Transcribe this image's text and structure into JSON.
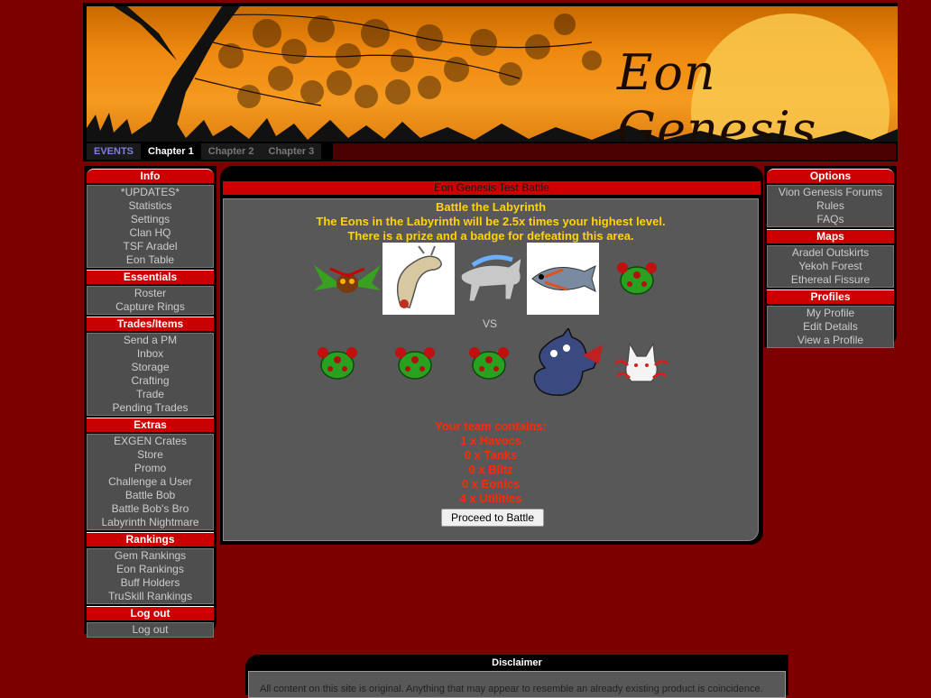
{
  "site": {
    "title": "Eon Genesis"
  },
  "tabs": [
    {
      "label": "EVENTS"
    },
    {
      "label": "Chapter 1"
    },
    {
      "label": "Chapter 2"
    },
    {
      "label": "Chapter 3"
    }
  ],
  "left_menu": [
    {
      "title": "Info",
      "items": [
        "*UPDATES*",
        "Statistics",
        "Settings",
        "Clan HQ",
        "TSF Aradel",
        "Eon Table"
      ]
    },
    {
      "title": "Essentials",
      "items": [
        "Roster",
        "Capture Rings"
      ]
    },
    {
      "title": "Trades/Items",
      "items": [
        "Send a PM",
        "Inbox",
        "Storage",
        "Crafting",
        "Trade",
        "Pending Trades"
      ]
    },
    {
      "title": "Extras",
      "items": [
        "EXGEN Crates",
        "Store",
        "Promo",
        "Challenge a User",
        "Battle Bob",
        "Battle Bob's Bro",
        "Labyrinth Nightmare"
      ]
    },
    {
      "title": "Rankings",
      "items": [
        "Gem Rankings",
        "Eon Rankings",
        "Buff Holders",
        "TruSkill Rankings"
      ]
    },
    {
      "title": "Log out",
      "items": [
        "Log out"
      ]
    }
  ],
  "right_menu": [
    {
      "title": "Options",
      "items": [
        "Vion Genesis Forums",
        "Rules",
        "FAQs"
      ]
    },
    {
      "title": "Maps",
      "items": [
        "Aradel Outskirts",
        "Yekoh Forest",
        "Ethereal Fissure"
      ]
    },
    {
      "title": "Profiles",
      "items": [
        "My Profile",
        "Edit Details",
        "View a Profile"
      ]
    }
  ],
  "battle": {
    "title": "Eon Genesis Test Battle",
    "heading": "Battle the Labyrinth",
    "line1": "The Eons in the Labyrinth will be 2.5x times your highest level.",
    "line2": "There is a prize and a badge for defeating this area.",
    "vs": "VS",
    "team_header": "Your team contains:",
    "team": [
      "1 x Havocs",
      "0 x Tanks",
      "0 x Blitz",
      "0 x Eonics",
      "4 x Utilities"
    ],
    "button": "Proceed to Battle"
  },
  "disclaimer": {
    "title": "Disclaimer",
    "text": "All content on this site is original. Anything that may appear to resemble an already existing product is coincidence."
  },
  "colors": {
    "background": "#7d0000",
    "accent": "#cc0000",
    "panel": "#585858",
    "highlight": "#ffd500",
    "team_text": "#ff2a00"
  }
}
